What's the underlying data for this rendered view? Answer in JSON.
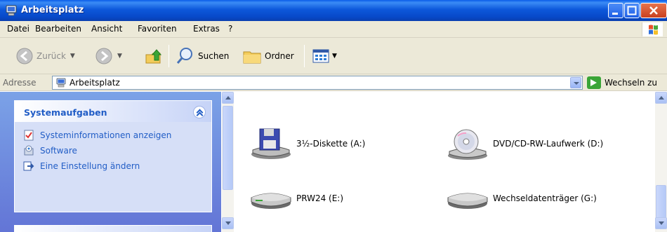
{
  "window": {
    "title": "Arbeitsplatz",
    "titlebar_color": "#0a5ce8"
  },
  "menubar": {
    "items": [
      "Datei",
      "Bearbeiten",
      "Ansicht",
      "Favoriten",
      "Extras",
      "?"
    ]
  },
  "toolbar": {
    "back_label": "Zurück",
    "search_label": "Suchen",
    "folders_label": "Ordner"
  },
  "addressbar": {
    "label": "Adresse",
    "value": "Arbeitsplatz",
    "go_label": "Wechseln zu"
  },
  "taskpane": {
    "title": "Systemaufgaben",
    "items": [
      {
        "label": "Systeminformationen anzeigen",
        "icon": "system-info-icon"
      },
      {
        "label": "Software",
        "icon": "software-icon"
      },
      {
        "label": "Eine Einstellung ändern",
        "icon": "settings-icon"
      }
    ],
    "link_color": "#215dc6"
  },
  "drives": [
    {
      "label": "3½-Diskette (A:)",
      "icon": "floppy-drive-icon"
    },
    {
      "label": "DVD/CD-RW-Laufwerk (D:)",
      "icon": "cd-drive-icon"
    },
    {
      "label": "PRW24 (E:)",
      "icon": "hard-drive-icon"
    },
    {
      "label": "Wechseldatenträger (G:)",
      "icon": "removable-drive-icon"
    }
  ]
}
